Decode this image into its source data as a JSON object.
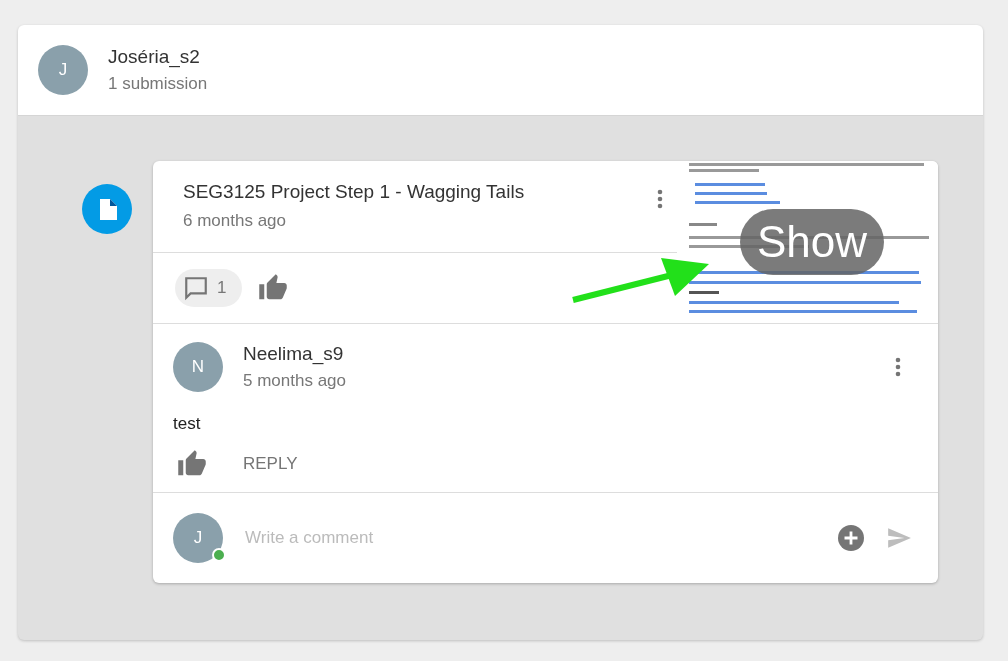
{
  "user": {
    "initial": "J",
    "name": "Joséria_s2",
    "subtitle": "1 submission"
  },
  "submission": {
    "title": "SEG3125 Project Step 1 - Wagging Tails",
    "time": "6 months ago",
    "comment_count": "1",
    "liked": false,
    "preview": {
      "kind": "picture",
      "overlay": "Show"
    }
  },
  "comments": [
    {
      "initial": "N",
      "name": "Neelima_s9",
      "time": "5 months ago",
      "text": "test",
      "liked": false,
      "reply": "REPLY"
    }
  ],
  "composer": {
    "initial": "J",
    "online": true,
    "placeholder": "Write a comment"
  }
}
